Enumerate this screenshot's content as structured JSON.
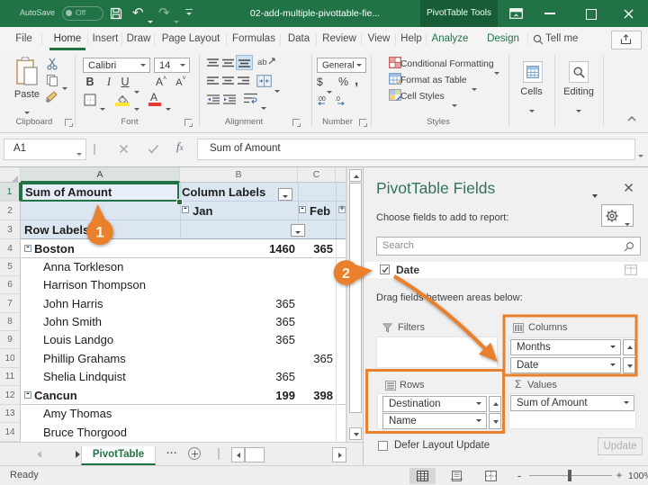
{
  "titlebar": {
    "autosave_label": "AutoSave",
    "autosave_state": "Off",
    "document_title": "02-add-multiple-pivottable-fie...",
    "contextual_tab": "PivotTable Tools"
  },
  "ribbon_tabs": [
    {
      "label": "File"
    },
    {
      "label": "Home",
      "active": true
    },
    {
      "label": "Insert"
    },
    {
      "label": "Draw"
    },
    {
      "label": "Page Layout"
    },
    {
      "label": "Formulas"
    },
    {
      "label": "Data"
    },
    {
      "label": "Review"
    },
    {
      "label": "View"
    },
    {
      "label": "Help"
    },
    {
      "label": "Analyze",
      "contextual": true
    },
    {
      "label": "Design",
      "contextual": true
    }
  ],
  "tellme_label": "Tell me",
  "ribbon": {
    "paste_label": "Paste",
    "clipboard_group": "Clipboard",
    "font_name": "Calibri",
    "font_size": "14",
    "font_group": "Font",
    "alignment_group": "Alignment",
    "number_format": "General",
    "number_group": "Number",
    "styles_items": [
      "Conditional Formatting",
      "Format as Table",
      "Cell Styles"
    ],
    "styles_group": "Styles",
    "cells_label": "Cells",
    "editing_label": "Editing"
  },
  "formula_bar": {
    "cell_ref": "A1",
    "formula": "Sum of Amount"
  },
  "grid": {
    "col_headers": [
      "A",
      "B",
      "C"
    ],
    "a1": "Sum of Amount",
    "b1": "Column Labels",
    "b2": "Jan",
    "c2": "Feb",
    "a3": "Row Labels",
    "rows": [
      {
        "n": "4",
        "label": "Boston",
        "group": true,
        "b": "1460",
        "c": "365"
      },
      {
        "n": "5",
        "label": "Anna Torkleson"
      },
      {
        "n": "6",
        "label": "Harrison Thompson"
      },
      {
        "n": "7",
        "label": "John Harris",
        "b": "365"
      },
      {
        "n": "8",
        "label": "John Smith",
        "b": "365"
      },
      {
        "n": "9",
        "label": "Louis Landgo",
        "b": "365"
      },
      {
        "n": "10",
        "label": "Phillip Grahams",
        "c": "365"
      },
      {
        "n": "11",
        "label": "Shelia Lindquist",
        "b": "365"
      },
      {
        "n": "12",
        "label": "Cancun",
        "group": true,
        "b": "199",
        "c": "398"
      },
      {
        "n": "13",
        "label": "Amy Thomas"
      },
      {
        "n": "14",
        "label": "Bruce Thorgood"
      }
    ],
    "sheet_tab": "PivotTable",
    "sheet_more": "..."
  },
  "status_bar": {
    "ready": "Ready",
    "zoom": "100%"
  },
  "task_pane": {
    "title": "PivotTable Fields",
    "subtitle": "Choose fields to add to report:",
    "search_placeholder": "Search",
    "field_date": "Date",
    "drag_hint": "Drag fields between areas below:",
    "zone_filters": "Filters",
    "zone_columns": "Columns",
    "zone_rows": "Rows",
    "zone_values": "Values",
    "columns_fields": [
      "Months",
      "Date"
    ],
    "rows_fields": [
      "Destination",
      "Name"
    ],
    "values_fields": [
      "Sum of Amount"
    ],
    "defer_label": "Defer Layout Update",
    "update_label": "Update"
  },
  "callouts": {
    "one": "1",
    "two": "2"
  },
  "colors": {
    "excel_green": "#217346",
    "annotation_orange": "#E8802D",
    "pivot_header_blue": "#DCE6F1"
  }
}
